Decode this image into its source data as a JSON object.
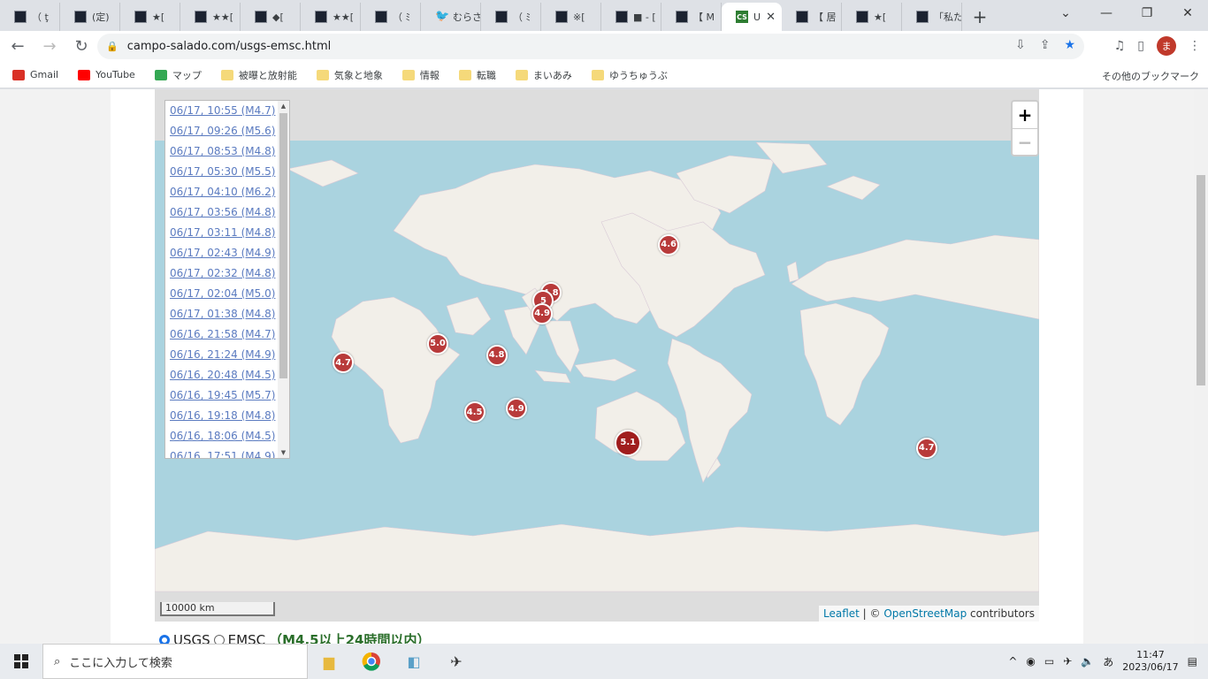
{
  "tabs": [
    {
      "label": "（ ţ"
    },
    {
      "label": "(定)"
    },
    {
      "label": "★["
    },
    {
      "label": "★★["
    },
    {
      "label": "◆["
    },
    {
      "label": "★★["
    },
    {
      "label": "（ ﾐ"
    },
    {
      "label": "むらさ",
      "icon": "twitter-icon"
    },
    {
      "label": "（ ﾐ"
    },
    {
      "label": "※["
    },
    {
      "label": "■ - ["
    },
    {
      "label": "【 M"
    },
    {
      "label": "U",
      "active": true,
      "favicon": "CS"
    },
    {
      "label": "【 居"
    },
    {
      "label": "★["
    },
    {
      "label": "「私た"
    }
  ],
  "url": "campo-salado.com/usgs-emsc.html",
  "avatar_letter": "ま",
  "bookmarks": [
    {
      "label": "Gmail",
      "icon": "gmail-icon"
    },
    {
      "label": "YouTube",
      "icon": "youtube-icon"
    },
    {
      "label": "マップ",
      "icon": "maps-icon"
    },
    {
      "label": "被曝と放射能",
      "icon": "folder-icon"
    },
    {
      "label": "気象と地象",
      "icon": "folder-icon"
    },
    {
      "label": "情報",
      "icon": "folder-icon"
    },
    {
      "label": "転職",
      "icon": "folder-icon"
    },
    {
      "label": "まいあみ",
      "icon": "folder-icon"
    },
    {
      "label": "ゆうちゅうぶ",
      "icon": "folder-icon"
    }
  ],
  "other_bookmarks": "その他のブックマーク",
  "quakes": [
    "06/17, 10:55 (M4.7)",
    "06/17, 09:26 (M5.6)",
    "06/17, 08:53 (M4.8)",
    "06/17, 05:30 (M5.5)",
    "06/17, 04:10 (M6.2)",
    "06/17, 03:56 (M4.8)",
    "06/17, 03:11 (M4.8)",
    "06/17, 02:43 (M4.9)",
    "06/17, 02:32 (M4.8)",
    "06/17, 02:04 (M5.0)",
    "06/17, 01:38 (M4.8)",
    "06/16, 21:58 (M4.7)",
    "06/16, 21:24 (M4.9)",
    "06/16, 20:48 (M4.5)",
    "06/16, 19:45 (M5.7)",
    "06/16, 19:18 (M4.8)",
    "06/16, 18:06 (M4.5)",
    "06/16, 17:51 (M4.9)"
  ],
  "markers": [
    {
      "mag": "4.6",
      "lon": -170.0,
      "lat": 51.5
    },
    {
      "mag": "4.8",
      "lon": 142.0,
      "lat": 37.5
    },
    {
      "mag": "5",
      "lon": 139.0,
      "lat": 35.0
    },
    {
      "mag": "4.9",
      "lon": 138.5,
      "lat": 30.5
    },
    {
      "mag": "4.8",
      "lon": -10.0,
      "lat": 36.5
    },
    {
      "mag": "5.0",
      "lon": 96.0,
      "lat": 19.5
    },
    {
      "mag": "4.8",
      "lon": 120.0,
      "lat": 15.0
    },
    {
      "mag": "4.7",
      "lon": 57.5,
      "lat": 12.0
    },
    {
      "mag": "4.9",
      "lon": 128.0,
      "lat": -6.5
    },
    {
      "mag": "4.5",
      "lon": 111.0,
      "lat": -8.0
    },
    {
      "mag": "4.7",
      "lon": -65.0,
      "lat": -22.0
    },
    {
      "mag": "5.1",
      "lon": 173.5,
      "lat": -20.0,
      "big": true
    }
  ],
  "map": {
    "scale_label": "10000 km",
    "attribution_leaflet": "Leaflet",
    "attribution_sep": " | © ",
    "attribution_osm": "OpenStreetMap",
    "attribution_tail": " contributors",
    "zoom_in": "+",
    "zoom_out": "−"
  },
  "controls": {
    "usgs": "USGS",
    "emsc": "EMSC",
    "condition": "（M4.5以上24時間以内）"
  },
  "taskbar": {
    "search_placeholder": "ここに入力して検索",
    "ime": "あ",
    "time": "11:47",
    "date": "2023/06/17"
  }
}
